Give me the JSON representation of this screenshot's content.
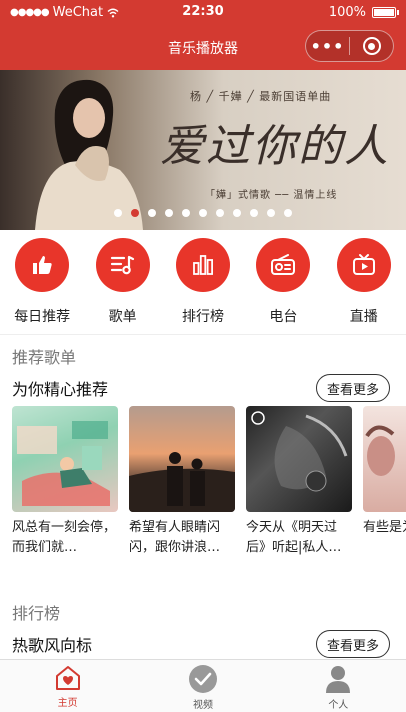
{
  "status_bar": {
    "carrier": "WeChat",
    "time": "22:30",
    "battery": "100%",
    "battery_level": 1.0
  },
  "navbar": {
    "title": "音乐播放器",
    "more_glyph": "•••"
  },
  "banner": {
    "subtitle": "杨 ╱ 千嬅 ╱ 最新国语单曲",
    "big_text": "爱过你的人",
    "tagline": "「嬅」式情歌 ── 温情上线",
    "dot_count": 11,
    "active_dot": 1
  },
  "menu": [
    {
      "label": "每日推荐",
      "icon": "thumbs-up-icon"
    },
    {
      "label": "歌单",
      "icon": "playlist-icon"
    },
    {
      "label": "排行榜",
      "icon": "bar-chart-icon"
    },
    {
      "label": "电台",
      "icon": "radio-icon"
    },
    {
      "label": "直播",
      "icon": "live-tv-icon"
    }
  ],
  "recommend": {
    "heading": "推荐歌单",
    "subheading": "为你精心推荐",
    "more_label": "查看更多",
    "cards": [
      {
        "title": "风总有一刻会停，而我们就…"
      },
      {
        "title": "希望有人眼睛闪闪，跟你讲浪…"
      },
      {
        "title": "今天从《明天过后》听起|私人…"
      },
      {
        "title": "有些是为"
      }
    ]
  },
  "ranking": {
    "heading": "排行榜",
    "subheading": "热歌风向标",
    "more_label": "查看更多"
  },
  "tabbar": [
    {
      "label": "主页",
      "icon": "home-icon",
      "active": true
    },
    {
      "label": "视频",
      "icon": "video-check-icon",
      "active": false
    },
    {
      "label": "个人",
      "icon": "user-icon",
      "active": false
    }
  ],
  "colors": {
    "brand": "#d33a31",
    "menu_circle": "#e8352a"
  }
}
